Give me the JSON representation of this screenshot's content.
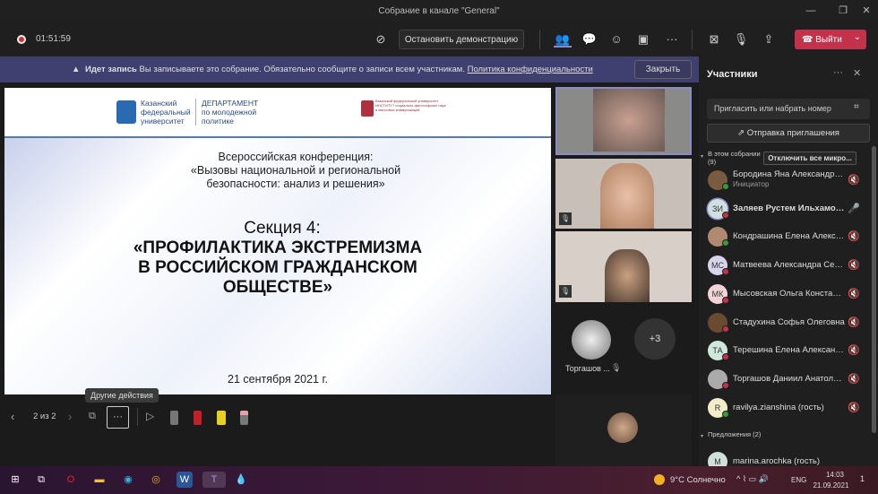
{
  "window": {
    "title": "Собрание в канале \"General\"",
    "min": "—",
    "max": "❐",
    "close": "✕"
  },
  "toolbar": {
    "timer": "01:51:59",
    "stop_share": "Остановить демонстрацию",
    "more": "···",
    "leave": "Выйти",
    "leave_chevron": "⌄"
  },
  "banner": {
    "title": "Идет запись",
    "text": "Вы записываете это собрание. Обязательно сообщите о записи всем участникам.",
    "link": "Политика конфиденциальности",
    "close": "Закрыть"
  },
  "slide": {
    "logo1": "Казанский федеральный университет",
    "logo2": "ДЕПАРТАМЕНТ по молодежной политике",
    "logo3": "Казанский федеральный университет ИНСТИТУТ социально-философских наук и массовых коммуникаций",
    "conf1": "Всероссийская конференция:",
    "conf2": "«Вызовы национальной и региональной",
    "conf3": "безопасности: анализ и решения»",
    "section": "Секция 4:",
    "heading1": "«ПРОФИЛАКТИКА ЭКСТРЕМИЗМА",
    "heading2": "В РОССИЙСКОМ ГРАЖДАНСКОМ",
    "heading3": "ОБЩЕСТВЕ»",
    "date": "21 сентября 2021 г."
  },
  "slide_controls": {
    "page": "2 из 2",
    "tooltip": "Другие действия",
    "more": "···"
  },
  "videos": {
    "tile_name": "Торгашов ...",
    "more_count": "+3"
  },
  "panel": {
    "title": "Участники",
    "search_placeholder": "Пригласить или набрать номер",
    "invite": "Отправка приглашения",
    "in_meeting": "В этом собрании",
    "in_meeting_count": "(9)",
    "mute_all": "Отключить все микро...",
    "suggestions": "Предложения (2)",
    "participants": [
      {
        "name": "Бородина Яна Александровна",
        "role": "Инициатор",
        "initials": "",
        "color": "#7a5a40",
        "status": "#3a9a3a",
        "mic": "muted"
      },
      {
        "name": "Заляев Рустем Ильхамович",
        "initials": "ЗИ",
        "color": "#cfe0e0",
        "status": "#c4314b",
        "mic": "on"
      },
      {
        "name": "Кондрашина Елена Алексее...",
        "initials": "",
        "color": "#b08a70",
        "status": "#3a9a3a",
        "mic": "muted"
      },
      {
        "name": "Матвеева Александра Серге...",
        "initials": "МС",
        "color": "#d8d4ec",
        "status": "#c4314b",
        "mic": "muted"
      },
      {
        "name": "Мысовская Ольга Константи...",
        "initials": "МК",
        "color": "#f2d4d8",
        "status": "#c4314b",
        "mic": "muted"
      },
      {
        "name": "Стадухина Софья Олеговна",
        "initials": "",
        "color": "#6a4a30",
        "status": "#c4314b",
        "mic": "muted"
      },
      {
        "name": "Терешина Елена Александр...",
        "initials": "ТА",
        "color": "#cde8dc",
        "status": "#c4314b",
        "mic": "muted"
      },
      {
        "name": "Торгашов Даниил Анатолье...",
        "initials": "",
        "color": "#aaaaaa",
        "status": "#c4314b",
        "mic": "muted"
      },
      {
        "name": "ravilya.zianshina (гость)",
        "initials": "R",
        "color": "#f3ecc8",
        "status": "#3a9a3a",
        "mic": "muted"
      }
    ],
    "suggested": [
      {
        "name": "marina.arochka (гость)",
        "initials": "M",
        "color": "#cfe0d8"
      }
    ]
  },
  "taskbar": {
    "weather": "9°C Солнечно",
    "lang": "ENG",
    "time": "14:03",
    "date": "21.09.2021",
    "notif": "1"
  }
}
